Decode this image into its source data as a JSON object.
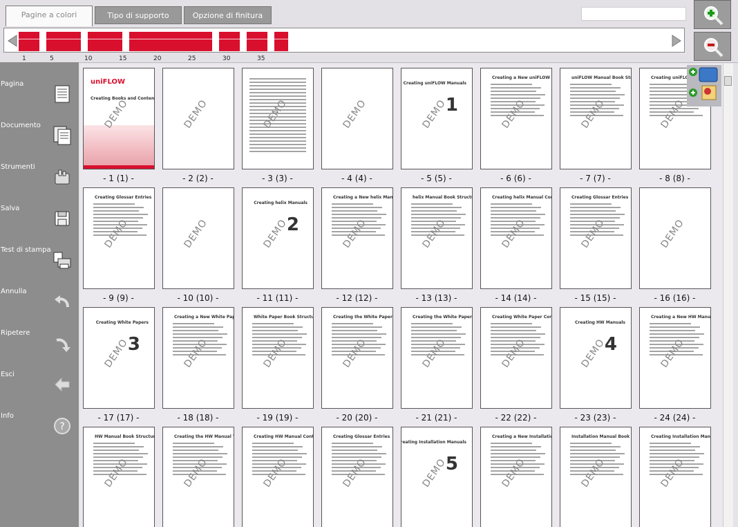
{
  "tabs": [
    {
      "label": "Pagine a colori",
      "active": true
    },
    {
      "label": "Tipo di supporto",
      "active": false
    },
    {
      "label": "Opzione di finitura",
      "active": false
    }
  ],
  "page_strip": {
    "tick_labels": [
      "1",
      "5",
      "10",
      "15",
      "20",
      "25",
      "30",
      "35"
    ],
    "cells": [
      "red",
      "red",
      "red",
      "white",
      "red",
      "red",
      "red",
      "red",
      "red",
      "white",
      "red",
      "red",
      "red",
      "red",
      "red",
      "white",
      "red",
      "red",
      "red",
      "red",
      "red",
      "red",
      "red",
      "red",
      "red",
      "red",
      "red",
      "red",
      "white",
      "red",
      "red",
      "red",
      "white",
      "red",
      "red",
      "red",
      "white",
      "red",
      "red",
      "white"
    ]
  },
  "zoom": {
    "in_icon": "zoom-in-icon",
    "out_icon": "zoom-out-icon"
  },
  "sidebar": [
    {
      "label": "Pagina",
      "icon": "page-icon"
    },
    {
      "label": "Documento",
      "icon": "document-icon"
    },
    {
      "label": "Strumenti",
      "icon": "tools-icon"
    },
    {
      "label": "Salva",
      "icon": "save-icon"
    },
    {
      "label": "Test di stampa",
      "icon": "test-print-icon"
    },
    {
      "label": "Annulla",
      "icon": "undo-icon"
    },
    {
      "label": "Ripetere",
      "icon": "redo-icon"
    },
    {
      "label": "Esci",
      "icon": "exit-icon"
    },
    {
      "label": "Info",
      "icon": "help-icon"
    }
  ],
  "watermark": "DEMO",
  "pages": [
    {
      "label": "- 1 (1) -",
      "kind": "cover",
      "title": "Creating Books and Content",
      "brand": "uniFLOW"
    },
    {
      "label": "- 2 (2) -",
      "kind": "blank"
    },
    {
      "label": "- 3 (3) -",
      "kind": "toc"
    },
    {
      "label": "- 4 (4) -",
      "kind": "blank"
    },
    {
      "label": "- 5 (5) -",
      "kind": "chapter",
      "title": "Creating uniFLOW Manuals",
      "num": "1"
    },
    {
      "label": "- 6 (6) -",
      "kind": "text",
      "title": "Creating a New uniFLOW Manual Book"
    },
    {
      "label": "- 7 (7) -",
      "kind": "text",
      "title": "uniFLOW Manual Book Structure"
    },
    {
      "label": "- 8 (8) -",
      "kind": "text",
      "title": "Creating uniFLOW Manual Contents"
    },
    {
      "label": "- 9 (9) -",
      "kind": "text",
      "title": "Creating Glossar Entries"
    },
    {
      "label": "- 10 (10) -",
      "kind": "blank"
    },
    {
      "label": "- 11 (11) -",
      "kind": "chapter",
      "title": "Creating helix Manuals",
      "num": "2"
    },
    {
      "label": "- 12 (12) -",
      "kind": "text",
      "title": "Creating a New helix Manual Book"
    },
    {
      "label": "- 13 (13) -",
      "kind": "text",
      "title": "helix Manual Book Structure"
    },
    {
      "label": "- 14 (14) -",
      "kind": "text",
      "title": "Creating helix Manual Contents"
    },
    {
      "label": "- 15 (15) -",
      "kind": "text",
      "title": "Creating Glossar Entries"
    },
    {
      "label": "- 16 (16) -",
      "kind": "blank"
    },
    {
      "label": "- 17 (17) -",
      "kind": "chapter",
      "title": "Creating White Papers",
      "num": "3"
    },
    {
      "label": "- 18 (18) -",
      "kind": "text",
      "title": "Creating a New White Paper Book"
    },
    {
      "label": "- 19 (19) -",
      "kind": "text",
      "title": "White Paper Book Structure"
    },
    {
      "label": "- 20 (20) -",
      "kind": "text",
      "title": "Creating the White Paper Title Page"
    },
    {
      "label": "- 21 (21) -",
      "kind": "text",
      "title": "Creating the White Paper Frontmatter"
    },
    {
      "label": "- 22 (22) -",
      "kind": "text",
      "title": "Creating White Paper Contents"
    },
    {
      "label": "- 23 (23) -",
      "kind": "chapter",
      "title": "Creating HW Manuals",
      "num": "4"
    },
    {
      "label": "- 24 (24) -",
      "kind": "text",
      "title": "Creating a New HW Manual Book"
    },
    {
      "label": "",
      "kind": "text",
      "title": "HW Manual Book Structure"
    },
    {
      "label": "",
      "kind": "text",
      "title": "Creating the HW Manual Title Page"
    },
    {
      "label": "",
      "kind": "text",
      "title": "Creating HW Manual Contents"
    },
    {
      "label": "",
      "kind": "text",
      "title": "Creating Glossar Entries"
    },
    {
      "label": "",
      "kind": "chapter",
      "title": "Creating Installation Manuals",
      "num": "5"
    },
    {
      "label": "",
      "kind": "text",
      "title": "Creating a New Installation Manual Book"
    },
    {
      "label": "",
      "kind": "text",
      "title": "Installation Manual Book Structure"
    },
    {
      "label": "",
      "kind": "text",
      "title": "Creating Installation Manual Contents"
    }
  ]
}
